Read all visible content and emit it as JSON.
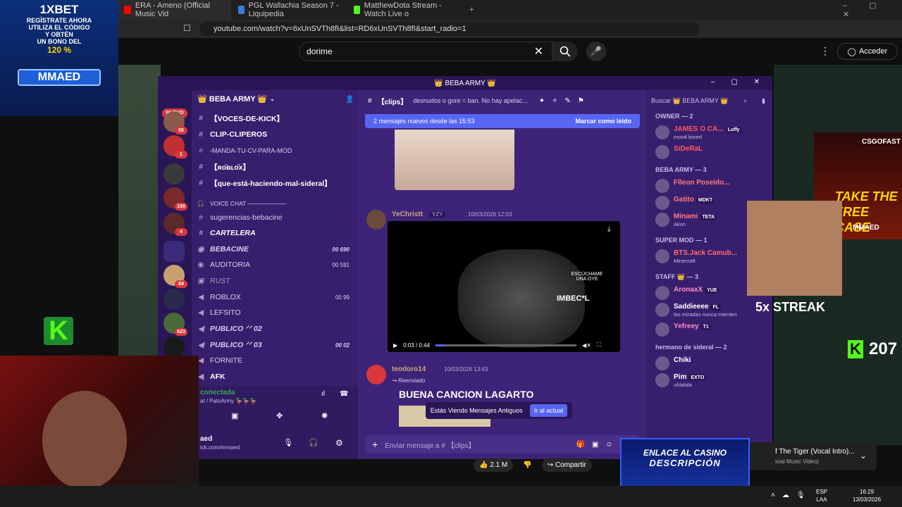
{
  "browser": {
    "tabs": [
      {
        "title": "ERA - Ameno (Official Music Vid",
        "color": "#ff0000"
      },
      {
        "title": "PGL Wallachia Season 7 - Liquipedia",
        "color": "#3a7bd5"
      },
      {
        "title": "MatthewDota Stream - Watch Live o",
        "color": "#53fc18"
      }
    ],
    "url": "youtube.com/watch?v=6xUnSVTh8fI&list=RD6xUnSVTh8fI&start_radio=1"
  },
  "youtube": {
    "search_value": "dorime",
    "signin_label": "Acceder",
    "likes": "2.1 M",
    "share_label": "Compartir",
    "now_playing_title": "f The Tiger (Vocal Intro)...",
    "now_playing_sub": "icial Music Video)"
  },
  "ads": {
    "betting": {
      "brand": "1XBET",
      "line1": "REGÍSTRATE AHORA",
      "line2": "UTILIZA EL CÓDIGO",
      "line3": "Y OBTÉN",
      "line4": "UN BONO DEL",
      "bonus": "120 %",
      "code": "MMAED"
    },
    "case": {
      "brand": "CSGOFAST",
      "headline": "TAKE THE FREE CASE",
      "code": "MMAED"
    },
    "streak": "5x STREAK",
    "kick_count": "207",
    "casino": {
      "line1": "ENLACE AL CASINO",
      "line2": "DESCRIPCIÓN"
    }
  },
  "discord": {
    "window_title": "👑 BEBA ARMY 👑",
    "server_name": "👑 BEBA ARMY 👑",
    "new_badge": "NUEVO",
    "server_badges": [
      "55",
      "1",
      "190",
      "4",
      "84",
      "623"
    ],
    "channels": [
      {
        "name": "【VOCES-DE-KICK】",
        "icon": "#",
        "bold": true,
        "count": ""
      },
      {
        "name": "CLIP-CLIPEROS",
        "icon": "#",
        "bold": true,
        "count": ""
      },
      {
        "name": "-MANDA-TU-CV-PARA-MOD",
        "icon": "#",
        "bold": false,
        "count": ""
      },
      {
        "name": "【ʀᴏ̈ʙʟᴏ̈x】",
        "icon": "#",
        "bold": true,
        "count": ""
      },
      {
        "name": "【que-está-haciendo-mal-sideral】",
        "icon": "#",
        "bold": true,
        "count": ""
      }
    ],
    "voice_category": "VOICE CHAT ─────────",
    "voice_channels": [
      {
        "name": "sugerencias-bebacine",
        "icon": "#",
        "count": ""
      },
      {
        "name": "CARTELERA",
        "icon": "#",
        "count": ""
      },
      {
        "name": "BEBACINE",
        "icon": "◉",
        "count": "00  690"
      },
      {
        "name": "AUDITORIA",
        "icon": "◉",
        "count": "00  591"
      },
      {
        "name": "RUST",
        "icon": "🔒",
        "count": ""
      },
      {
        "name": "ROBLOX",
        "icon": "🔊",
        "count": "00  99"
      },
      {
        "name": "LEFSITO",
        "icon": "🔊",
        "count": ""
      },
      {
        "name": "PUBLICO ᐟᐟ 02",
        "icon": "🔊",
        "count": ""
      },
      {
        "name": "PUBLICO ᐟᐟ 03",
        "icon": "🔊",
        "count": "00  02"
      },
      {
        "name": "FORNITE",
        "icon": "🔊",
        "count": ""
      },
      {
        "name": "AFK",
        "icon": "🔊",
        "count": ""
      }
    ],
    "voice_status": "conectada",
    "voice_sub": "al / PatoArmy 🦆🦆🦆",
    "user_name": "aed",
    "user_sub": "ick.com/mmaed",
    "chat": {
      "channel": "【clips】",
      "topic": "desnudos o gore = ban. No hay apelac...",
      "search_placeholder": "Buscar 👑 BEBA ARMY 👑",
      "new_messages": "2 mensajes nuevos desde las 15:53",
      "mark_read": "Marcar como leído",
      "msg1_author": "YeChristt",
      "msg1_tag": "YZY",
      "msg1_time": "10/03/2026 12:03",
      "video_text1": "ESCÚCHAME UNA OYE",
      "video_text2": "IMBEC*L",
      "video_time": "0:03 / 0:44",
      "msg2_author": "teodoro14",
      "msg2_time": "10/03/2026 13:43",
      "msg2_forward": "Reenviado",
      "msg2_text": "BUENA CANCION LAGARTO",
      "old_msgs": "Estás Viendo Mensajes Antiguos",
      "go_current": "Ir al actual",
      "input_placeholder": "Enviar mensaje a #  【clips】"
    },
    "members": {
      "groups": [
        {
          "title": "OWNER — 2",
          "items": [
            {
              "name": "JAMES O CA...",
              "tag": "Luffy",
              "status": "mood bored",
              "color": "#ff5a5a"
            },
            {
              "name": "SiDeRaL",
              "tag": "",
              "status": "",
              "color": "#ff5a5a"
            }
          ]
        },
        {
          "title": "BEBA ARMY — 3",
          "items": [
            {
              "name": "Flleon Poseido...",
              "tag": "",
              "status": "",
              "color": "#ff7a7a"
            },
            {
              "name": "Gatito",
              "tag": "MDKT",
              "status": "",
              "color": "#ff7a7a"
            },
            {
              "name": "Minami",
              "tag": "TETA",
              "status": "Akon",
              "color": "#ff7a7a"
            }
          ]
        },
        {
          "title": "SUPER MOD — 1",
          "items": [
            {
              "name": "BTS.Jack Camub...",
              "tag": "",
              "status": "Minecraft",
              "color": "#ff6a6a"
            }
          ]
        },
        {
          "title": "STAFF 👑 — 3",
          "items": [
            {
              "name": "AronaxX",
              "tag": "YUE",
              "status": "",
              "color": "#ff8ac8"
            },
            {
              "name": "Saddieeee",
              "tag": "FL",
              "status": "las miradas nunca mienten",
              "color": "#ffffff"
            },
            {
              "name": "Yefreey",
              "tag": "T1",
              "status": "",
              "color": "#ff8ac8"
            }
          ]
        },
        {
          "title": "hermano de sideral — 2",
          "items": [
            {
              "name": "Chiki",
              "tag": "",
              "status": "",
              "color": "#ffffff"
            },
            {
              "name": "Pim",
              "tag": "EXTO",
              "status": "uhlalala",
              "color": "#ffffff"
            }
          ]
        }
      ]
    }
  },
  "taskbar": {
    "lang1": "ESP",
    "lang2": "LAA",
    "time": "16:29",
    "date": "13/03/2026"
  }
}
